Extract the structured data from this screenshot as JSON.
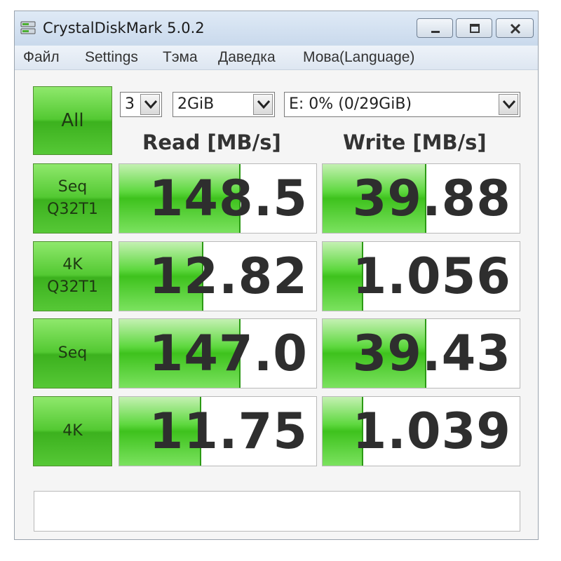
{
  "window": {
    "title": "CrystalDiskMark 5.0.2",
    "app_icon": "disk-icon"
  },
  "menu": [
    "Файл",
    "Settings",
    "Тэма",
    "Даведка",
    "Мова(Language)"
  ],
  "controls": {
    "all_label": "All",
    "count_value": "3",
    "size_value": "2GiB",
    "drive_value": "E: 0% (0/29GiB)"
  },
  "headers": {
    "read": "Read [MB/s]",
    "write": "Write [MB/s]"
  },
  "rows": [
    {
      "label1": "Seq",
      "label2": "Q32T1",
      "read": "148.5",
      "write": "39.88",
      "read_fill": 0.61,
      "write_fill": 0.52
    },
    {
      "label1": "4K",
      "label2": "Q32T1",
      "read": "12.82",
      "write": "1.056",
      "read_fill": 0.42,
      "write_fill": 0.2
    },
    {
      "label1": "Seq",
      "label2": "",
      "read": "147.0",
      "write": "39.43",
      "read_fill": 0.61,
      "write_fill": 0.52
    },
    {
      "label1": "4K",
      "label2": "",
      "read": "11.75",
      "write": "1.039",
      "read_fill": 0.41,
      "write_fill": 0.2
    }
  ],
  "status_text": "",
  "colors": {
    "accent_green": "#3ec21d",
    "title_bg": "#c9d9ec"
  }
}
